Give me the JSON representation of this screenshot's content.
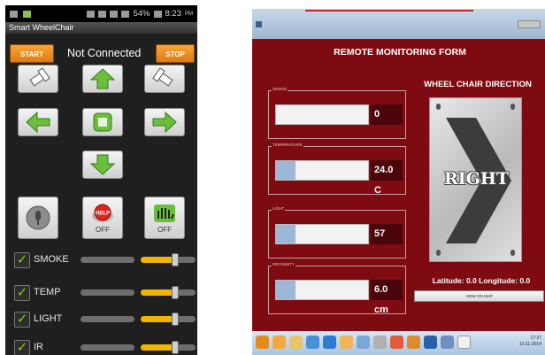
{
  "phone": {
    "status": {
      "battery": "54%",
      "time": "8:23",
      "ampm": "PM"
    },
    "app_title": "Smart WheelChair",
    "start_label": "START",
    "stop_label": "STOP",
    "connection_status": "Not Connected",
    "help_badge": "HELP",
    "help_toggle": "OFF",
    "gesture_toggle": "OFF",
    "sensors": [
      {
        "label": "SMOKE",
        "checked": true
      },
      {
        "label": "TEMP",
        "checked": true
      },
      {
        "label": "LIGHT",
        "checked": true
      },
      {
        "label": "IR",
        "checked": true
      }
    ]
  },
  "desktop": {
    "form_title": "REMOTE MONITORING FORM",
    "smoke": {
      "label": "SMOKE",
      "value": "0",
      "level": 0.0
    },
    "temperature": {
      "label": "TEMPERATURE",
      "value": "24.0 C",
      "level": 0.22
    },
    "light": {
      "label": "LIGHT",
      "value": "57",
      "level": 0.22
    },
    "proximity": {
      "label": "PROXIMITY",
      "value": "6.0 cm",
      "level": 0.22
    },
    "direction_title": "WHEEL CHAIR DIRECTION",
    "direction": "RIGHT",
    "location": "Latitude: 0.0 Longitude: 0.0",
    "map_button": "VIEW ON MAP",
    "clock": {
      "time": "17:37",
      "date": "11-11-2014"
    }
  },
  "colors": {
    "panel": "#7d0b11",
    "accent_orange": "#f08c1e",
    "arrow_green": "#6cbf3a",
    "toggle_yellow": "#f1b400"
  }
}
